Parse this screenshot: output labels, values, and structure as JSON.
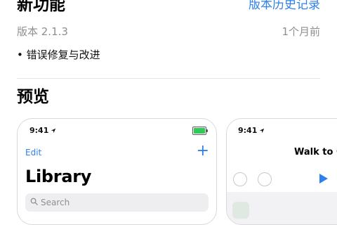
{
  "whats_new": {
    "title": "新功能",
    "history_link": "版本历史记录",
    "version": "版本 2.1.3",
    "time_ago": "1个月前",
    "notes": [
      "• 错误修复与改进"
    ]
  },
  "preview": {
    "title": "预览",
    "screenshots": [
      {
        "status_time": "9:41",
        "edit_label": "Edit",
        "add_glyph": "+",
        "title": "Library",
        "search_placeholder": "Search"
      },
      {
        "status_time": "9:41",
        "title": "Walk to Co"
      }
    ]
  },
  "colors": {
    "accent": "#2f80ed",
    "secondary_text": "#8e8e93",
    "battery": "#34c759"
  },
  "icons": [
    "location-arrow-icon",
    "battery-icon",
    "plus-icon",
    "search-icon",
    "play-icon",
    "undo-icon",
    "redo-icon"
  ]
}
